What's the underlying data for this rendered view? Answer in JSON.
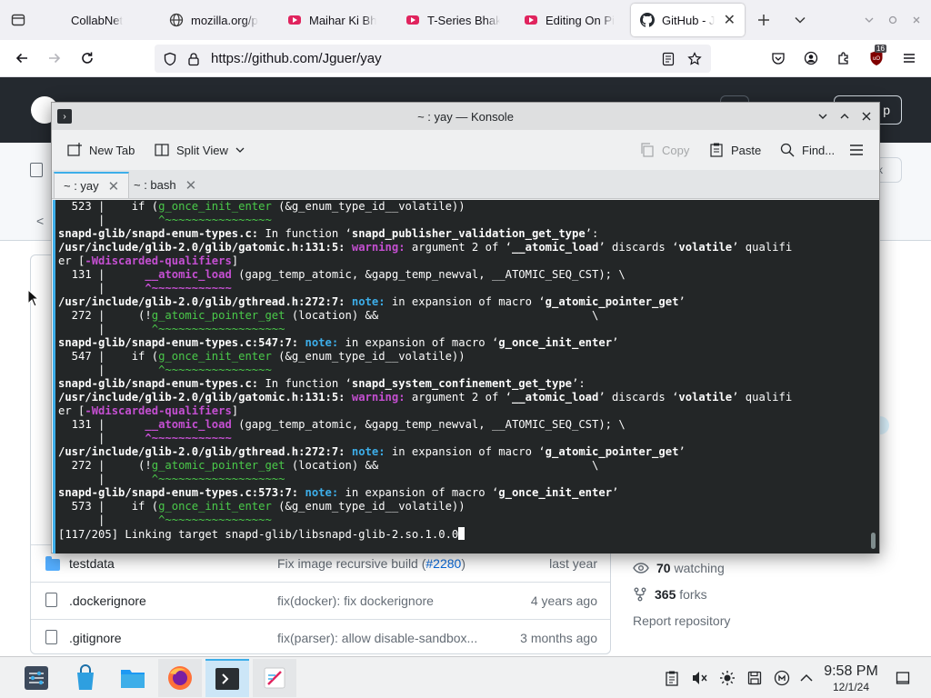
{
  "browser": {
    "tabs": [
      {
        "title": "CollabNet",
        "icon": "collabnet-icon"
      },
      {
        "title": "mozilla.org/p",
        "icon": "mozilla-icon"
      },
      {
        "title": "Maihar Ki Bh",
        "icon": "youtube-icon"
      },
      {
        "title": "T-Series Bhak",
        "icon": "youtube-icon"
      },
      {
        "title": "Editing On Pi",
        "icon": "youtube-icon"
      },
      {
        "title": "GitHub - Jg",
        "icon": "github-icon",
        "active": true
      }
    ],
    "url": "https://github.com/Jguer/yay",
    "extension_badge": "16"
  },
  "konsole": {
    "title": "~ : yay — Konsole",
    "toolbar": {
      "new_tab": "New Tab",
      "split_view": "Split View",
      "copy": "Copy",
      "paste": "Paste",
      "find": "Find..."
    },
    "tabs": [
      {
        "label": "~ : yay",
        "active": true
      },
      {
        "label": "~ : bash",
        "active": false
      }
    ],
    "terminal_lines": [
      {
        "segs": [
          {
            "t": "  523 |    if ("
          },
          {
            "t": "g_once_init_enter",
            "c": "t-green"
          },
          {
            "t": " (&g_enum_type_id__volatile))"
          }
        ]
      },
      {
        "segs": [
          {
            "t": "      |        "
          },
          {
            "t": "^~~~~~~~~~~~~~~~~",
            "c": "t-green"
          }
        ]
      },
      {
        "segs": [
          {
            "t": "snapd-glib/snapd-enum-types.c:",
            "c": "t-bold"
          },
          {
            "t": " In function "
          },
          {
            "t": "‘"
          },
          {
            "t": "snapd_publisher_validation_get_type",
            "c": "t-bold"
          },
          {
            "t": "’:"
          }
        ]
      },
      {
        "segs": [
          {
            "t": "/usr/include/glib-2.0/glib/gatomic.h:131:5:",
            "c": "t-bold"
          },
          {
            "t": " "
          },
          {
            "t": "warning:",
            "c": "t-magenta"
          },
          {
            "t": " argument 2 of ‘"
          },
          {
            "t": "__atomic_load",
            "c": "t-bold"
          },
          {
            "t": "’ discards ‘"
          },
          {
            "t": "volatile",
            "c": "t-bold"
          },
          {
            "t": "’ qualifi"
          }
        ]
      },
      {
        "segs": [
          {
            "t": "er ["
          },
          {
            "t": "-Wdiscarded-qualifiers",
            "c": "t-magenta"
          },
          {
            "t": "]"
          }
        ]
      },
      {
        "segs": [
          {
            "t": "  131 |      "
          },
          {
            "t": "__atomic_load",
            "c": "t-magenta"
          },
          {
            "t": " (gapg_temp_atomic, &gapg_temp_newval, __ATOMIC_SEQ_CST); \\"
          }
        ]
      },
      {
        "segs": [
          {
            "t": "      |      "
          },
          {
            "t": "^~~~~~~~~~~~~",
            "c": "t-magenta"
          }
        ]
      },
      {
        "segs": [
          {
            "t": "/usr/include/glib-2.0/glib/gthread.h:272:7:",
            "c": "t-bold"
          },
          {
            "t": " "
          },
          {
            "t": "note:",
            "c": "t-cyan"
          },
          {
            "t": " in expansion of macro ‘"
          },
          {
            "t": "g_atomic_pointer_get",
            "c": "t-bold"
          },
          {
            "t": "’"
          }
        ]
      },
      {
        "segs": [
          {
            "t": "  272 |     (!"
          },
          {
            "t": "g_atomic_pointer_get",
            "c": "t-green"
          },
          {
            "t": " (location) &&                                \\"
          }
        ]
      },
      {
        "segs": [
          {
            "t": "      |       "
          },
          {
            "t": "^~~~~~~~~~~~~~~~~~~~",
            "c": "t-green"
          }
        ]
      },
      {
        "segs": [
          {
            "t": "snapd-glib/snapd-enum-types.c:547:7:",
            "c": "t-bold"
          },
          {
            "t": " "
          },
          {
            "t": "note:",
            "c": "t-cyan"
          },
          {
            "t": " in expansion of macro ‘"
          },
          {
            "t": "g_once_init_enter",
            "c": "t-bold"
          },
          {
            "t": "’"
          }
        ]
      },
      {
        "segs": [
          {
            "t": "  547 |    if ("
          },
          {
            "t": "g_once_init_enter",
            "c": "t-green"
          },
          {
            "t": " (&g_enum_type_id__volatile))"
          }
        ]
      },
      {
        "segs": [
          {
            "t": "      |        "
          },
          {
            "t": "^~~~~~~~~~~~~~~~~",
            "c": "t-green"
          }
        ]
      },
      {
        "segs": [
          {
            "t": "snapd-glib/snapd-enum-types.c:",
            "c": "t-bold"
          },
          {
            "t": " In function "
          },
          {
            "t": "‘"
          },
          {
            "t": "snapd_system_confinement_get_type",
            "c": "t-bold"
          },
          {
            "t": "’:"
          }
        ]
      },
      {
        "segs": [
          {
            "t": "/usr/include/glib-2.0/glib/gatomic.h:131:5:",
            "c": "t-bold"
          },
          {
            "t": " "
          },
          {
            "t": "warning:",
            "c": "t-magenta"
          },
          {
            "t": " argument 2 of ‘"
          },
          {
            "t": "__atomic_load",
            "c": "t-bold"
          },
          {
            "t": "’ discards ‘"
          },
          {
            "t": "volatile",
            "c": "t-bold"
          },
          {
            "t": "’ qualifi"
          }
        ]
      },
      {
        "segs": [
          {
            "t": "er ["
          },
          {
            "t": "-Wdiscarded-qualifiers",
            "c": "t-magenta"
          },
          {
            "t": "]"
          }
        ]
      },
      {
        "segs": [
          {
            "t": "  131 |      "
          },
          {
            "t": "__atomic_load",
            "c": "t-magenta"
          },
          {
            "t": " (gapg_temp_atomic, &gapg_temp_newval, __ATOMIC_SEQ_CST); \\"
          }
        ]
      },
      {
        "segs": [
          {
            "t": "      |      "
          },
          {
            "t": "^~~~~~~~~~~~~",
            "c": "t-magenta"
          }
        ]
      },
      {
        "segs": [
          {
            "t": "/usr/include/glib-2.0/glib/gthread.h:272:7:",
            "c": "t-bold"
          },
          {
            "t": " "
          },
          {
            "t": "note:",
            "c": "t-cyan"
          },
          {
            "t": " in expansion of macro ‘"
          },
          {
            "t": "g_atomic_pointer_get",
            "c": "t-bold"
          },
          {
            "t": "’"
          }
        ]
      },
      {
        "segs": [
          {
            "t": "  272 |     (!"
          },
          {
            "t": "g_atomic_pointer_get",
            "c": "t-green"
          },
          {
            "t": " (location) &&                                \\"
          }
        ]
      },
      {
        "segs": [
          {
            "t": "      |       "
          },
          {
            "t": "^~~~~~~~~~~~~~~~~~~~",
            "c": "t-green"
          }
        ]
      },
      {
        "segs": [
          {
            "t": "snapd-glib/snapd-enum-types.c:573:7:",
            "c": "t-bold"
          },
          {
            "t": " "
          },
          {
            "t": "note:",
            "c": "t-cyan"
          },
          {
            "t": " in expansion of macro ‘"
          },
          {
            "t": "g_once_init_enter",
            "c": "t-bold"
          },
          {
            "t": "’"
          }
        ]
      },
      {
        "segs": [
          {
            "t": "  573 |    if ("
          },
          {
            "t": "g_once_init_enter",
            "c": "t-green"
          },
          {
            "t": " (&g_enum_type_id__volatile))"
          }
        ]
      },
      {
        "segs": [
          {
            "t": "      |        "
          },
          {
            "t": "^~~~~~~~~~~~~~~~~",
            "c": "t-green"
          }
        ]
      },
      {
        "segs": [
          {
            "t": "[117/205] Linking target snapd-glib/libsnapd-glib-2.so.1.0.0"
          }
        ],
        "cursor": true
      }
    ]
  },
  "github": {
    "files": [
      {
        "name": "testdata",
        "type": "folder",
        "message": "Fix image recursive build (",
        "link": "#2280",
        "message_end": ")",
        "age": "last year"
      },
      {
        "name": ".dockerignore",
        "type": "file",
        "message": "fix(docker): fix dockerignore",
        "age": "4 years ago"
      },
      {
        "name": ".gitignore",
        "type": "file",
        "message": "fix(parser): allow disable-sandbox...",
        "age": "3 months ago"
      }
    ],
    "about": {
      "watching_count": "70",
      "watching_label": "watching",
      "forks_count": "365",
      "forks_label": "forks",
      "report": "Report repository"
    }
  },
  "taskbar": {
    "apps": [
      "settings-icon",
      "discover-icon",
      "dolphin-icon",
      "firefox-icon",
      "konsole-icon",
      "kate-icon"
    ],
    "clock_time": "9:58 PM",
    "clock_date": "12/1/24"
  },
  "colors": {
    "konsole_accent": "#3daee9",
    "terminal_bg": "#232627",
    "github_header": "#24292f"
  }
}
